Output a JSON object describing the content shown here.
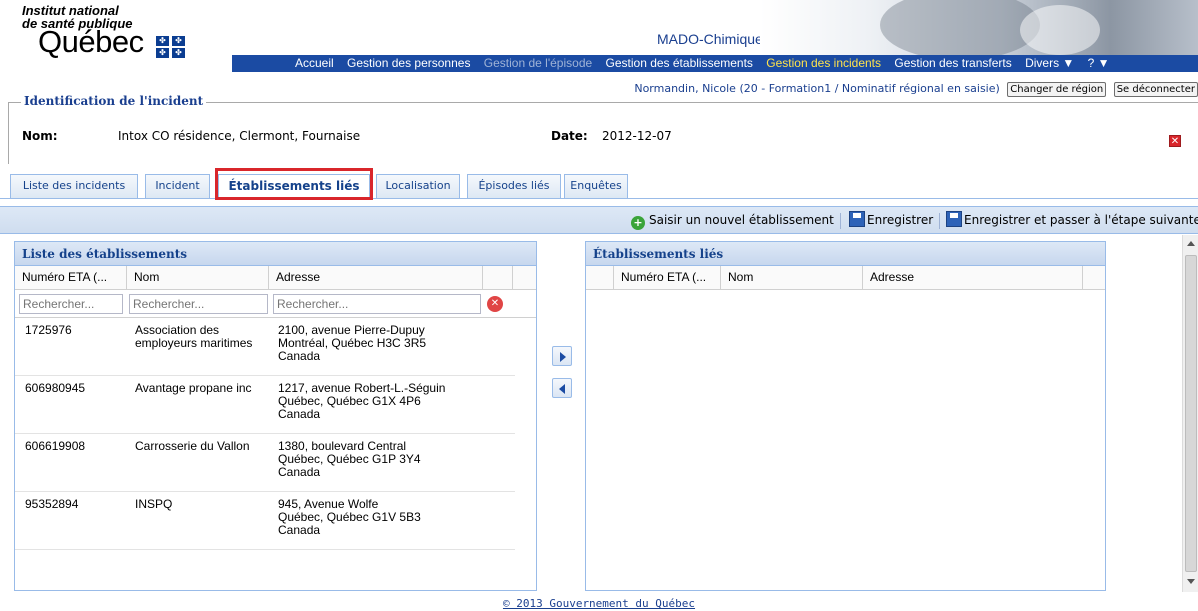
{
  "header": {
    "institute_line1": "Institut national",
    "institute_line2": "de santé publique",
    "quebec": "Québec",
    "app_title": "MADO-Chimique"
  },
  "nav": {
    "items": [
      {
        "label": "Accueil",
        "state": "normal"
      },
      {
        "label": "Gestion des personnes",
        "state": "normal"
      },
      {
        "label": "Gestion de l'épisode",
        "state": "disabled"
      },
      {
        "label": "Gestion des établissements",
        "state": "normal"
      },
      {
        "label": "Gestion des incidents",
        "state": "active"
      },
      {
        "label": "Gestion des transferts",
        "state": "normal"
      },
      {
        "label": "Divers ▼",
        "state": "normal"
      },
      {
        "label": "? ▼",
        "state": "normal"
      }
    ]
  },
  "user": {
    "info": "Normandin, Nicole (20 - Formation1 / Nominatif régional en saisie)",
    "change_region": "Changer de région",
    "logout": "Se déconnecter"
  },
  "identification": {
    "legend": "Identification de l'incident",
    "nom_label": "Nom:",
    "nom_value": "Intox CO résidence, Clermont, Fournaise",
    "date_label": "Date:",
    "date_value": "2012-12-07"
  },
  "tabs": [
    {
      "label": "Liste des incidents"
    },
    {
      "label": "Incident"
    },
    {
      "label": "Établissements liés"
    },
    {
      "label": "Localisation"
    },
    {
      "label": "Épisodes liés"
    },
    {
      "label": "Enquêtes"
    }
  ],
  "toolbar": {
    "new_label": "Saisir un nouvel établissement",
    "save_label": "Enregistrer",
    "save_next_label": "Enregistrer et passer à l'étape suivante"
  },
  "left_panel": {
    "title": "Liste des établissements",
    "columns": [
      "Numéro ETA (...",
      "Nom",
      "Adresse"
    ],
    "search_placeholder": "Rechercher...",
    "rows": [
      {
        "eta": "1725976",
        "nom1": "Association des",
        "nom2": "employeurs maritimes",
        "addr1": "2100, avenue Pierre-Dupuy",
        "addr2": "Montréal, Québec H3C 3R5",
        "addr3": "Canada"
      },
      {
        "eta": "606980945",
        "nom1": "Avantage propane inc",
        "nom2": "",
        "addr1": "1217, avenue Robert-L.-Séguin",
        "addr2": "Québec, Québec G1X 4P6",
        "addr3": "Canada"
      },
      {
        "eta": "606619908",
        "nom1": "Carrosserie du Vallon",
        "nom2": "",
        "addr1": "1380, boulevard Central",
        "addr2": "Québec, Québec G1P 3Y4",
        "addr3": "Canada"
      },
      {
        "eta": "95352894",
        "nom1": "INSPQ",
        "nom2": "",
        "addr1": "945, Avenue Wolfe",
        "addr2": "Québec, Québec G1V 5B3",
        "addr3": "Canada"
      }
    ]
  },
  "right_panel": {
    "title": "Établissements liés",
    "columns": [
      "Numéro ETA (...",
      "Nom",
      "Adresse"
    ]
  },
  "footer": {
    "text": "© 2013 Gouvernement du Québec"
  },
  "colors": {
    "nav_bg": "#1b4ba3",
    "active_nav": "#ffe34d",
    "highlight": "#d9262b",
    "panel_border": "#99bbe8"
  }
}
